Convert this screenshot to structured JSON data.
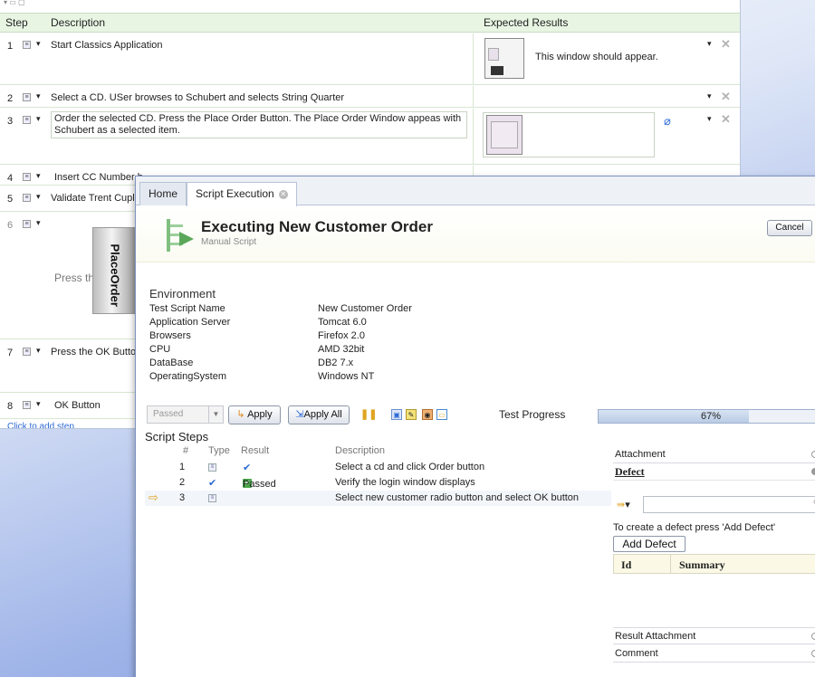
{
  "editor": {
    "columns": {
      "step": "Step",
      "description": "Description",
      "expected": "Expected Results"
    },
    "rows": [
      {
        "num": "1",
        "desc": "Start Classics Application",
        "expected_text": "This window should appear."
      },
      {
        "num": "2",
        "desc": "Select a CD.  USer browses to Schubert  and selects String Quarter"
      },
      {
        "num": "3",
        "desc": "Order the selected CD.  Press the Place Order Button.   The Place Order Window appeas with Schubert as a selected item."
      },
      {
        "num": "4",
        "desc": "Insert CC Number b"
      },
      {
        "num": "5",
        "desc": "Validate Trent Cuplit"
      },
      {
        "num": "6",
        "desc": "Press the",
        "button_image_text": "PlaceOrder"
      },
      {
        "num": "7",
        "desc": "Press the OK Button"
      },
      {
        "num": "8",
        "desc": "OK Button"
      }
    ],
    "add_step": "Click to add step"
  },
  "exec": {
    "tabs": {
      "home": "Home",
      "script_execution": "Script Execution"
    },
    "title": "Executing New Customer Order",
    "subtitle": "Manual Script",
    "cancel": "Cancel",
    "environment": {
      "title": "Environment",
      "rows": [
        {
          "k": "Test Script Name",
          "v": "New Customer Order"
        },
        {
          "k": "Application Server",
          "v": "Tomcat 6.0"
        },
        {
          "k": "Browsers",
          "v": "Firefox 2.0"
        },
        {
          "k": "CPU",
          "v": "AMD 32bit"
        },
        {
          "k": "DataBase",
          "v": "DB2 7.x"
        },
        {
          "k": "OperatingSystem",
          "v": "Windows NT"
        }
      ]
    },
    "toolbar": {
      "status_value": "Passed",
      "apply": "Apply",
      "apply_all": "Apply All",
      "progress_label": "Test Progress",
      "progress_value": 0.67,
      "progress_text": "67%"
    },
    "steps": {
      "title": "Script Steps",
      "headers": {
        "num": "#",
        "type": "Type",
        "result": "Result",
        "description": "Description"
      },
      "rows": [
        {
          "num": "1",
          "result": "",
          "description": "Select a cd and click Order button"
        },
        {
          "num": "2",
          "result": "Passed",
          "description": "Verify the login window displays"
        },
        {
          "num": "3",
          "result": "",
          "description": "Select new customer radio button and select OK button"
        }
      ]
    },
    "panel": {
      "attachment": "Attachment",
      "defect": "Defect",
      "defect_hint": "To create a defect press 'Add Defect'",
      "add_defect": "Add Defect",
      "col_id": "Id",
      "col_summary": "Summary",
      "result_attachment": "Result Attachment",
      "comment": "Comment"
    }
  },
  "colors": {
    "accent": "#2d6ad6",
    "passed": "#4aa64a",
    "header_green": "#e8f5e3"
  }
}
